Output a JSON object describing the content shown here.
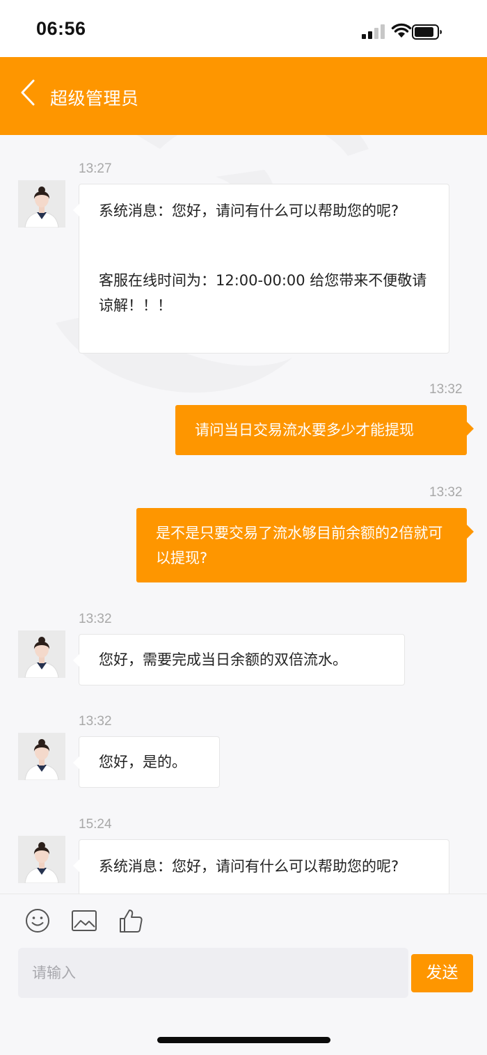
{
  "status_bar": {
    "time": "06:56"
  },
  "header": {
    "title": "超级管理员"
  },
  "messages": [
    {
      "side": "left",
      "time": "13:27",
      "paragraphs": [
        "系统消息：您好，请问有什么可以帮助您的呢?",
        "客服在线时间为：12:00-00:00 给您带来不便敬请谅解！！！"
      ]
    },
    {
      "side": "right",
      "time": "13:32",
      "text": "请问当日交易流水要多少才能提现"
    },
    {
      "side": "right",
      "time": "13:32",
      "text": "是不是只要交易了流水够目前余额的2倍就可以提现?"
    },
    {
      "side": "left",
      "time": "13:32",
      "text": "您好，需要完成当日余额的双倍流水。"
    },
    {
      "side": "left",
      "time": "13:32",
      "text": "您好，是的。"
    },
    {
      "side": "left",
      "time": "15:24",
      "text": "系统消息：您好，请问有什么可以帮助您的呢?"
    }
  ],
  "input": {
    "placeholder": "请输入",
    "send_label": "发送"
  },
  "toolbar": {
    "icons": [
      "emoji-icon",
      "image-icon",
      "thumbs-up-icon"
    ]
  },
  "colors": {
    "accent": "#fe9600",
    "background": "#f7f7f9",
    "bubble_left": "#ffffff"
  }
}
